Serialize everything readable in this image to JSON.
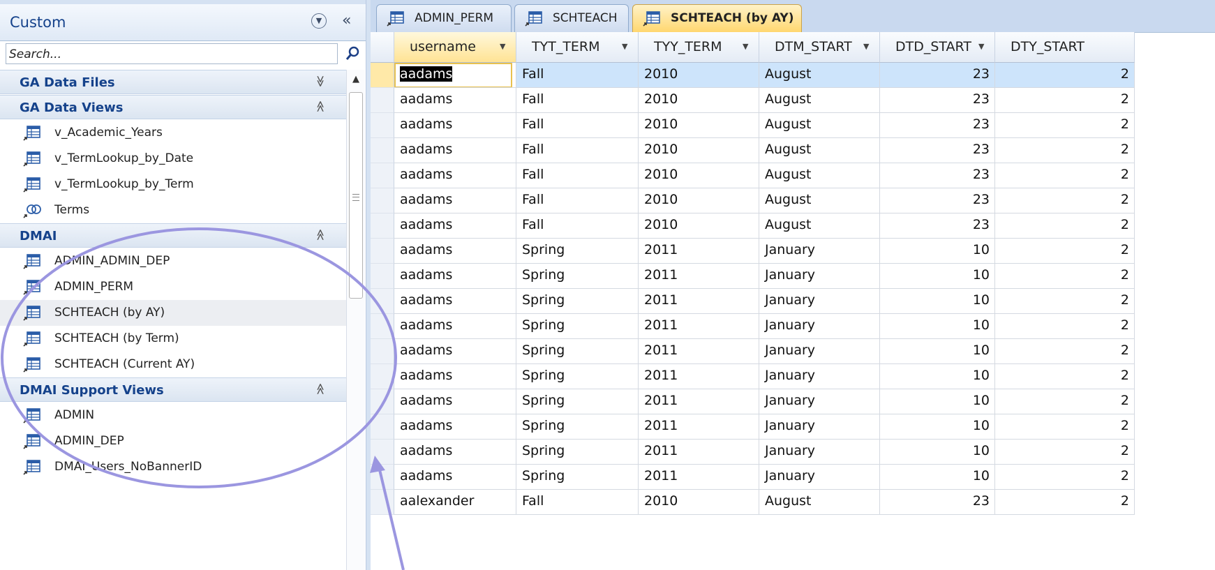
{
  "nav": {
    "title": "Custom",
    "dropdown_icon": "circle-chevron-down-icon",
    "collapse_icon": "double-chevron-left-icon",
    "search_placeholder": "Search...",
    "groups": [
      {
        "label": "GA Data Files",
        "chevron": "expand-icon",
        "items": []
      },
      {
        "label": "GA Data Views",
        "chevron": "collapse-icon",
        "items": [
          {
            "label": "v_Academic_Years",
            "icon": "linked-table-icon"
          },
          {
            "label": "v_TermLookup_by_Date",
            "icon": "linked-table-icon"
          },
          {
            "label": "v_TermLookup_by_Term",
            "icon": "linked-table-icon"
          },
          {
            "label": "Terms",
            "icon": "linked-query-icon"
          }
        ]
      },
      {
        "label": "DMAI",
        "chevron": "collapse-icon",
        "items": [
          {
            "label": "ADMIN_ADMIN_DEP",
            "icon": "linked-table-icon"
          },
          {
            "label": "ADMIN_PERM",
            "icon": "linked-table-icon"
          },
          {
            "label": "SCHTEACH (by AY)",
            "icon": "linked-table-icon",
            "selected": true
          },
          {
            "label": "SCHTEACH (by Term)",
            "icon": "linked-table-icon"
          },
          {
            "label": "SCHTEACH (Current AY)",
            "icon": "linked-table-icon"
          }
        ]
      },
      {
        "label": "DMAI Support Views",
        "chevron": "collapse-icon",
        "items": [
          {
            "label": "ADMIN",
            "icon": "linked-table-icon"
          },
          {
            "label": "ADMIN_DEP",
            "icon": "linked-table-icon"
          },
          {
            "label": "DMAI_Users_NoBannerID",
            "icon": "linked-table-icon"
          }
        ]
      }
    ]
  },
  "tabs": [
    {
      "label": "ADMIN_PERM",
      "active": false
    },
    {
      "label": "SCHTEACH",
      "active": false
    },
    {
      "label": "SCHTEACH (by AY)",
      "active": true
    }
  ],
  "columns": [
    "username",
    "TYT_TERM",
    "TYY_TERM",
    "DTM_START",
    "DTD_START",
    "DTY_START"
  ],
  "rows": [
    [
      "aadams",
      "Fall",
      "2010",
      "August",
      "23",
      "2"
    ],
    [
      "aadams",
      "Fall",
      "2010",
      "August",
      "23",
      "2"
    ],
    [
      "aadams",
      "Fall",
      "2010",
      "August",
      "23",
      "2"
    ],
    [
      "aadams",
      "Fall",
      "2010",
      "August",
      "23",
      "2"
    ],
    [
      "aadams",
      "Fall",
      "2010",
      "August",
      "23",
      "2"
    ],
    [
      "aadams",
      "Fall",
      "2010",
      "August",
      "23",
      "2"
    ],
    [
      "aadams",
      "Fall",
      "2010",
      "August",
      "23",
      "2"
    ],
    [
      "aadams",
      "Spring",
      "2011",
      "January",
      "10",
      "2"
    ],
    [
      "aadams",
      "Spring",
      "2011",
      "January",
      "10",
      "2"
    ],
    [
      "aadams",
      "Spring",
      "2011",
      "January",
      "10",
      "2"
    ],
    [
      "aadams",
      "Spring",
      "2011",
      "January",
      "10",
      "2"
    ],
    [
      "aadams",
      "Spring",
      "2011",
      "January",
      "10",
      "2"
    ],
    [
      "aadams",
      "Spring",
      "2011",
      "January",
      "10",
      "2"
    ],
    [
      "aadams",
      "Spring",
      "2011",
      "January",
      "10",
      "2"
    ],
    [
      "aadams",
      "Spring",
      "2011",
      "January",
      "10",
      "2"
    ],
    [
      "aadams",
      "Spring",
      "2011",
      "January",
      "10",
      "2"
    ],
    [
      "aadams",
      "Spring",
      "2011",
      "January",
      "10",
      "2"
    ],
    [
      "aalexander",
      "Fall",
      "2010",
      "August",
      "23",
      "2"
    ]
  ],
  "colors": {
    "nav_header_text": "#15428b",
    "active_tab": "#ffd770",
    "selected_row": "#cde4fb",
    "annotation": "#9b96e0"
  }
}
